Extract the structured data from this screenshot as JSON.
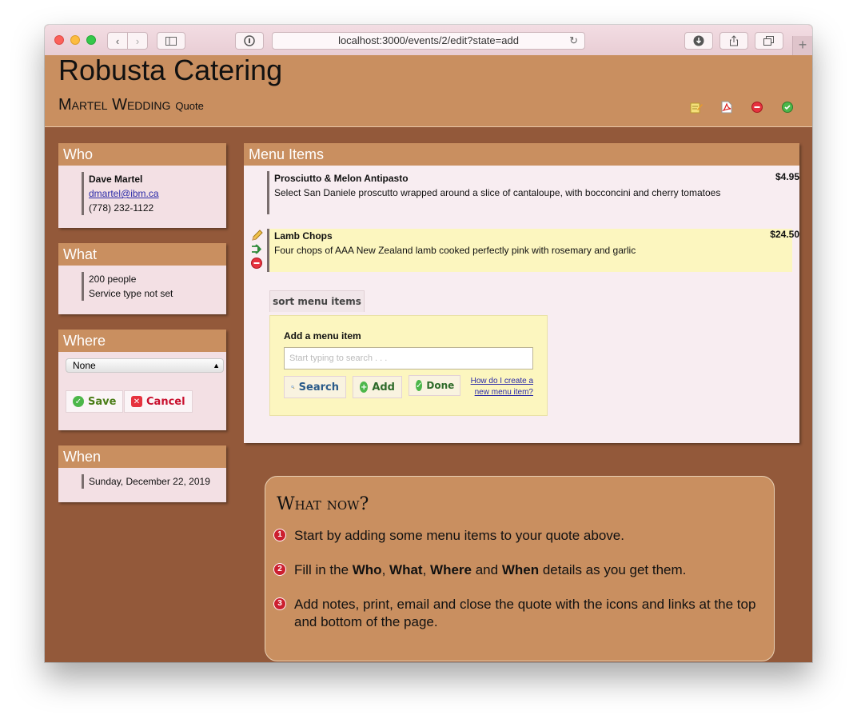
{
  "browser": {
    "url": "localhost:3000/events/2/edit?state=add"
  },
  "header": {
    "site_title": "Robusta Catering",
    "event_name": "Martel Wedding",
    "event_type": "Quote",
    "icons": [
      "notes-icon",
      "pdf-icon",
      "delete-icon",
      "approve-icon"
    ]
  },
  "who": {
    "title": "Who",
    "name": "Dave Martel",
    "email": "dmartel@ibm.ca",
    "phone": "(778) 232-1122"
  },
  "what": {
    "title": "What",
    "people": "200 people",
    "service": "Service type not set"
  },
  "where": {
    "title": "Where",
    "selected": "None",
    "save_label": "Save",
    "cancel_label": "Cancel"
  },
  "when": {
    "title": "When",
    "date": "Sunday, December 22, 2019"
  },
  "menu": {
    "title": "Menu Items",
    "items": [
      {
        "name": "Prosciutto & Melon Antipasto",
        "description": "Select San Daniele proscutto wrapped around a slice of cantaloupe, with bocconcini and cherry tomatoes",
        "price": "$4.95"
      },
      {
        "name": "Lamb Chops",
        "description": "Four chops of AAA New Zealand lamb cooked perfectly pink with rosemary and garlic",
        "price": "$24.50"
      }
    ],
    "sort_label": "sort menu items",
    "add": {
      "title": "Add a menu item",
      "placeholder": "Start typing to search . . .",
      "search_label": "Search",
      "add_label": "Add",
      "done_label": "Done",
      "help_link": "How do I create a new menu item?"
    }
  },
  "what_now": {
    "title": "What now?",
    "steps": [
      {
        "num": "1",
        "text": "Start by adding some menu items to your quote above."
      },
      {
        "num": "2",
        "pre": "Fill in the ",
        "b1": "Who",
        "s1": ", ",
        "b2": "What",
        "s2": ", ",
        "b3": "Where",
        "s3": " and ",
        "b4": "When",
        "post": " details as you get them."
      },
      {
        "num": "3",
        "text": "Add notes, print, email and close the quote with the icons and links at the top and bottom of the page."
      }
    ]
  }
}
